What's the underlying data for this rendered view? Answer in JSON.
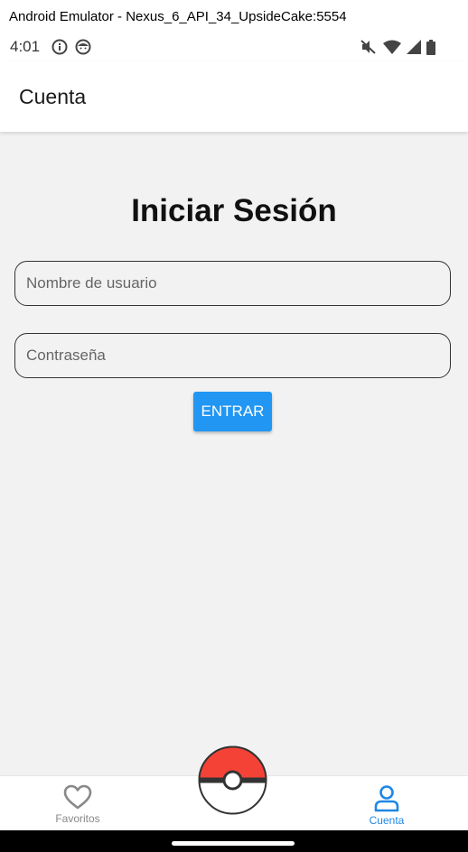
{
  "window": {
    "title": "Android Emulator - Nexus_6_API_34_UpsideCake:5554"
  },
  "status_bar": {
    "time": "4:01",
    "icons": [
      "info-icon",
      "face-icon",
      "mute-icon",
      "wifi-icon",
      "signal-icon",
      "battery-icon"
    ]
  },
  "app_bar": {
    "title": "Cuenta"
  },
  "login": {
    "title": "Iniciar Sesión",
    "username_placeholder": "Nombre de usuario",
    "username_value": "",
    "password_placeholder": "Contraseña",
    "password_value": "",
    "submit_label": "ENTRAR"
  },
  "bottom_nav": {
    "items": [
      {
        "label": "Favoritos",
        "icon": "heart-icon",
        "active": false
      },
      {
        "label": "Cuenta",
        "icon": "user-icon",
        "active": true
      }
    ],
    "center_icon": "pokeball-icon"
  },
  "colors": {
    "accent": "#2196f3",
    "active_nav": "#1e88e5",
    "inactive_nav": "#888888",
    "content_bg": "#f2f2f2",
    "pokeball_red": "#f44336"
  }
}
